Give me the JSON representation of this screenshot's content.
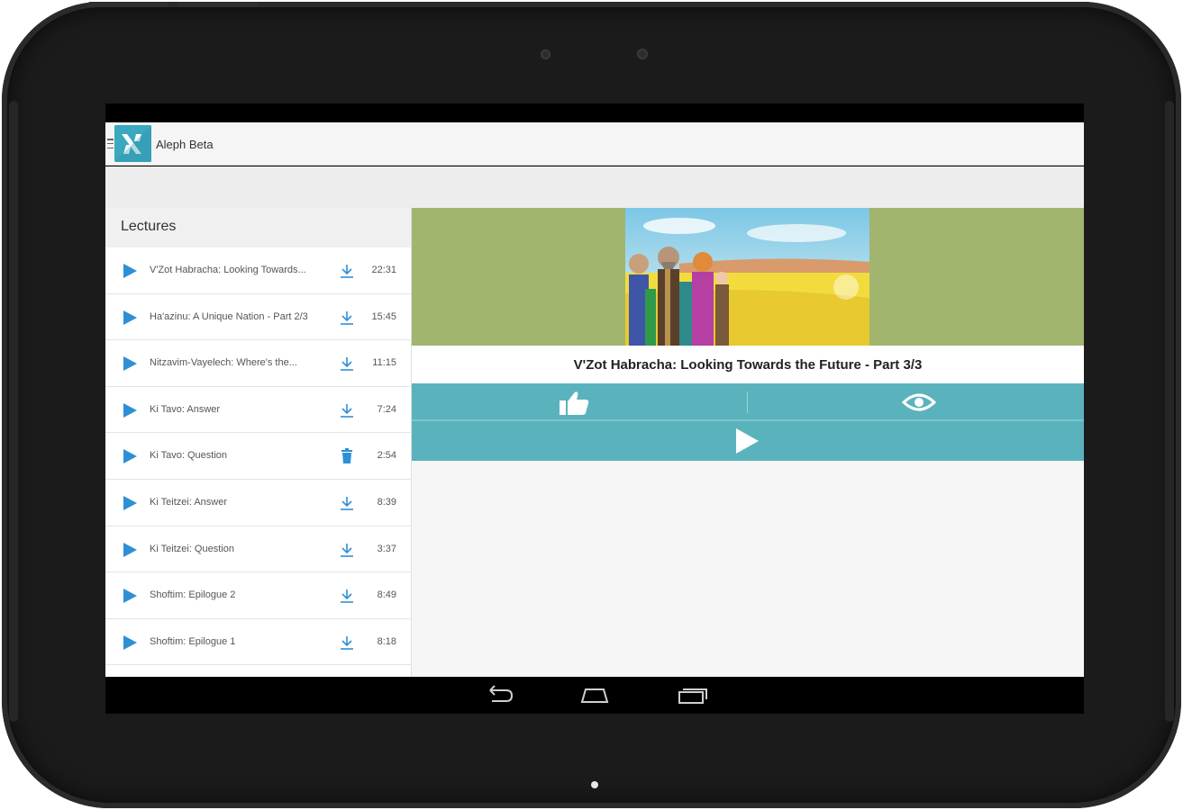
{
  "app": {
    "title": "Aleph Beta",
    "brand_color": "#3aa8bf",
    "accent_color": "#5ab3bc",
    "play_color": "#2f8fd6"
  },
  "lectures": {
    "header": "Lectures",
    "items": [
      {
        "title": "V'Zot Habracha: Looking Towards...",
        "duration": "22:31",
        "action": "download-icon"
      },
      {
        "title": "Ha'azinu: A Unique Nation - Part 2/3",
        "duration": "15:45",
        "action": "download-icon"
      },
      {
        "title": "Nitzavim-Vayelech: Where's the...",
        "duration": "11:15",
        "action": "download-icon"
      },
      {
        "title": "Ki Tavo: Answer",
        "duration": "7:24",
        "action": "download-icon"
      },
      {
        "title": "Ki Tavo: Question",
        "duration": "2:54",
        "action": "trash-icon"
      },
      {
        "title": "Ki Teitzei: Answer",
        "duration": "8:39",
        "action": "download-icon"
      },
      {
        "title": "Ki Teitzei: Question",
        "duration": "3:37",
        "action": "download-icon"
      },
      {
        "title": "Shoftim: Epilogue 2",
        "duration": "8:49",
        "action": "download-icon"
      },
      {
        "title": "Shoftim: Epilogue 1",
        "duration": "8:18",
        "action": "download-icon"
      }
    ]
  },
  "detail": {
    "video_title": "V'Zot Habracha: Looking Towards the Future - Part 3/3",
    "like_icon": "thumbs-up-icon",
    "views_icon": "eye-icon",
    "play_icon": "play-icon"
  },
  "navbar": {
    "buttons": [
      "back-icon",
      "home-icon",
      "recent-apps-icon"
    ]
  }
}
